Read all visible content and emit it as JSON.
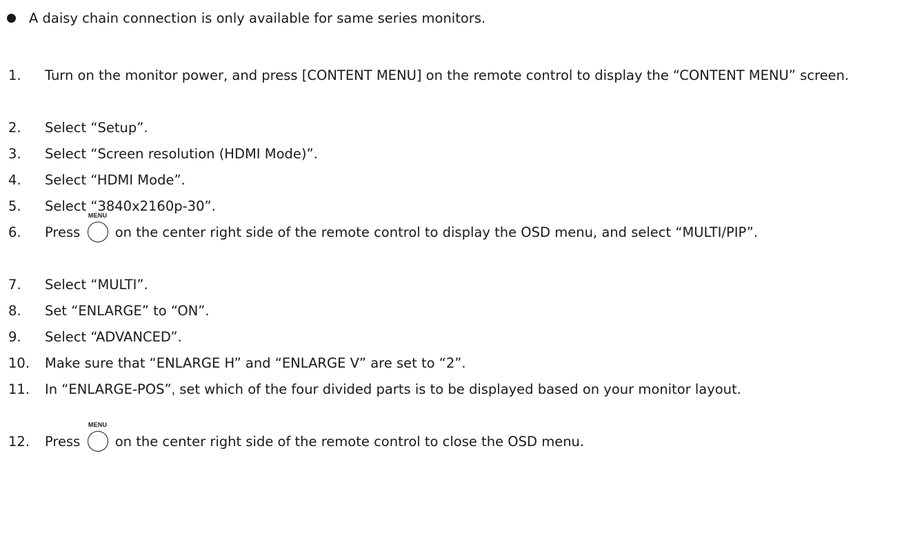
{
  "note": {
    "text": "A daisy chain connection is only available for same series monitors."
  },
  "menu_icon_label": "MENU",
  "steps": [
    {
      "num": "1.",
      "text": "Turn on the monitor power, and press [CONTENT MENU] on the remote control to display the “CONTENT MENU” screen."
    },
    {
      "num": "2.",
      "text": "Select “Setup”."
    },
    {
      "num": "3.",
      "text": "Select “Screen resolution (HDMI Mode)”."
    },
    {
      "num": "4.",
      "text": "Select “HDMI Mode”."
    },
    {
      "num": "5.",
      "text": "Select “3840x2160p-30”."
    },
    {
      "num": "6.",
      "pre": "Press",
      "post": "on the center right side of the remote control to display the OSD menu, and select “MULTI/PIP”."
    },
    {
      "num": "7.",
      "text": "Select “MULTI”."
    },
    {
      "num": "8.",
      "text": "Set “ENLARGE” to “ON”."
    },
    {
      "num": "9.",
      "text": "Select “ADVANCED”."
    },
    {
      "num": "10.",
      "text": "Make sure that “ENLARGE H” and “ENLARGE V” are set to “2”."
    },
    {
      "num": "11.",
      "pre": "In “ENLARGE-POS”",
      "comma": ",",
      "post": " set which of the four divided parts is to be displayed based on your monitor layout."
    },
    {
      "num": "12.",
      "pre": "Press",
      "post": "on the center right side of the remote control to close the OSD menu."
    }
  ]
}
